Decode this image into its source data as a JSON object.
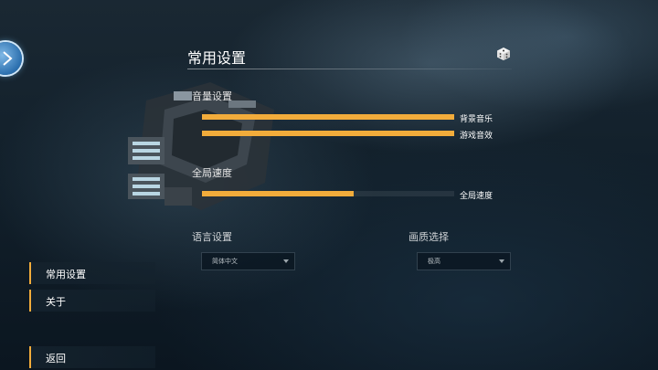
{
  "header": {
    "title": "常用设置"
  },
  "sections": {
    "volume": "音量设置",
    "speed": "全局速度",
    "language": "语言设置",
    "quality": "画质选择"
  },
  "sliders": {
    "music": {
      "label": "背景音乐",
      "value": 1.0
    },
    "sfx": {
      "label": "游戏音效",
      "value": 1.0
    },
    "speed": {
      "label": "全局速度",
      "value": 0.6
    }
  },
  "dropdowns": {
    "language": {
      "selected": "简体中文"
    },
    "quality": {
      "selected": "极高"
    }
  },
  "menu": {
    "items": [
      {
        "label": "常用设置"
      },
      {
        "label": "关于"
      },
      {
        "label": "返回"
      }
    ]
  },
  "icons": {
    "back_orb": "back-arrow-icon",
    "dice": "dice-icon"
  },
  "colors": {
    "accent": "#f2ac3b",
    "orb": "#2b6fae"
  }
}
